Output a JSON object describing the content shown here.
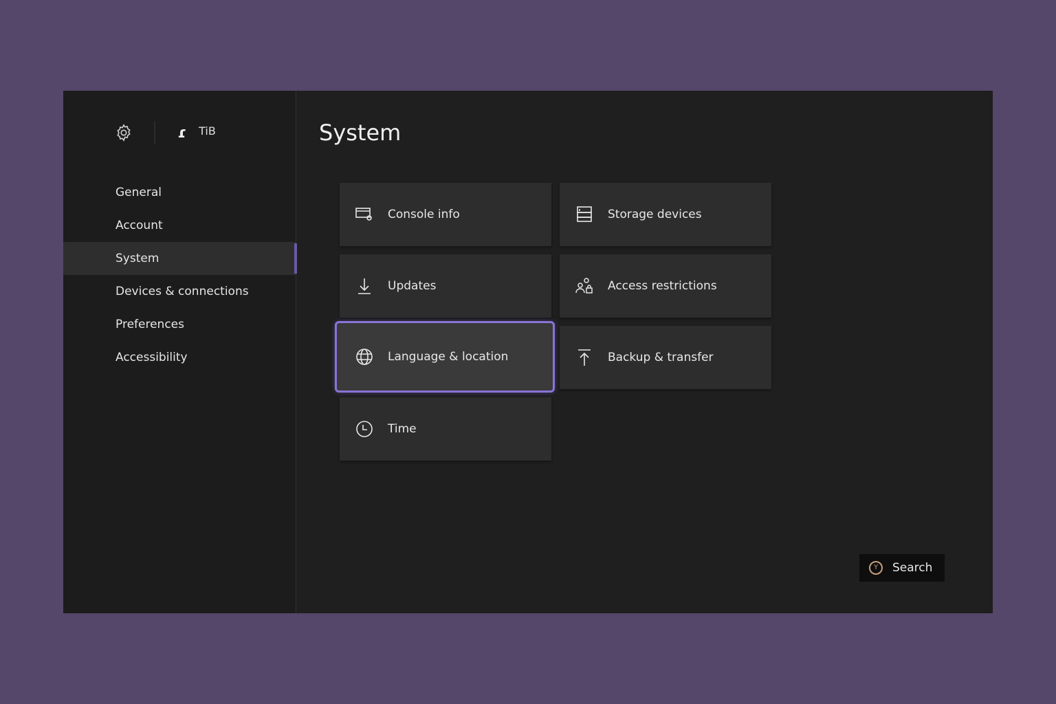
{
  "header": {
    "settings_icon": "gear-icon",
    "profile_glyph": "ɾ",
    "gamertag": "TiB"
  },
  "sidebar": {
    "items": [
      {
        "label": "General",
        "active": false
      },
      {
        "label": "Account",
        "active": false
      },
      {
        "label": "System",
        "active": true
      },
      {
        "label": "Devices & connections",
        "active": false
      },
      {
        "label": "Preferences",
        "active": false
      },
      {
        "label": "Accessibility",
        "active": false
      }
    ]
  },
  "main": {
    "title": "System",
    "tiles": [
      {
        "label": "Console info",
        "icon": "console-info-icon"
      },
      {
        "label": "Storage devices",
        "icon": "storage-icon"
      },
      {
        "label": "Updates",
        "icon": "download-icon"
      },
      {
        "label": "Access restrictions",
        "icon": "access-restrictions-icon"
      },
      {
        "label": "Language & location",
        "icon": "globe-icon",
        "focused": true
      },
      {
        "label": "Backup & transfer",
        "icon": "upload-icon"
      },
      {
        "label": "Time",
        "icon": "clock-icon"
      }
    ]
  },
  "search": {
    "button_glyph": "Y",
    "label": "Search"
  },
  "colors": {
    "background": "#54476a",
    "focus_accent": "#8a74d6",
    "y_button": "#c9a07a"
  }
}
